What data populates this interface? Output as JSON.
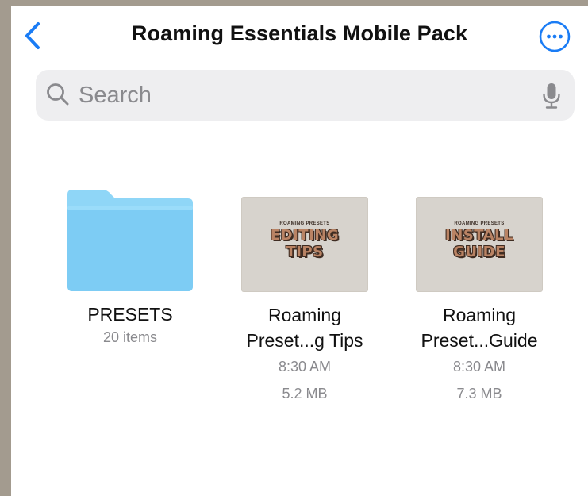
{
  "header": {
    "title": "Roaming Essentials Mobile Pack"
  },
  "search": {
    "placeholder": "Search"
  },
  "items": [
    {
      "name": "PRESETS",
      "subtitle": "20 items",
      "icon": "folder-icon"
    },
    {
      "name_line1": "Roaming",
      "name_line2": "Preset...g Tips",
      "time": "8:30 AM",
      "size": "5.2 MB",
      "thumb_small": "ROAMING PRESETS",
      "thumb_line1": "EDITING",
      "thumb_line2": "TIPS"
    },
    {
      "name_line1": "Roaming",
      "name_line2": "Preset...Guide",
      "time": "8:30 AM",
      "size": "7.3 MB",
      "thumb_small": "ROAMING PRESETS",
      "thumb_line1": "INSTALL",
      "thumb_line2": "GUIDE"
    }
  ],
  "colors": {
    "accent": "#1a7cf5",
    "folder": "#7fcdf5",
    "background": "#a39b8f",
    "thumbnail": "#d7d3cd"
  }
}
